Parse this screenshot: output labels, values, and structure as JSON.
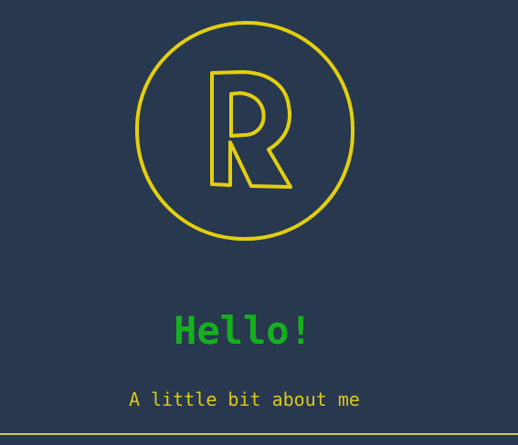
{
  "logo": {
    "letter": "R",
    "icon": "letter-r-logo-icon",
    "color": "#e3cf0f"
  },
  "intro": {
    "greeting": "Hello!",
    "subtitle": "A little bit about me"
  },
  "colors": {
    "background": "#28384f",
    "greeting": "#16b01e",
    "subtitle": "#dcc819",
    "rule": "#d8c870"
  }
}
